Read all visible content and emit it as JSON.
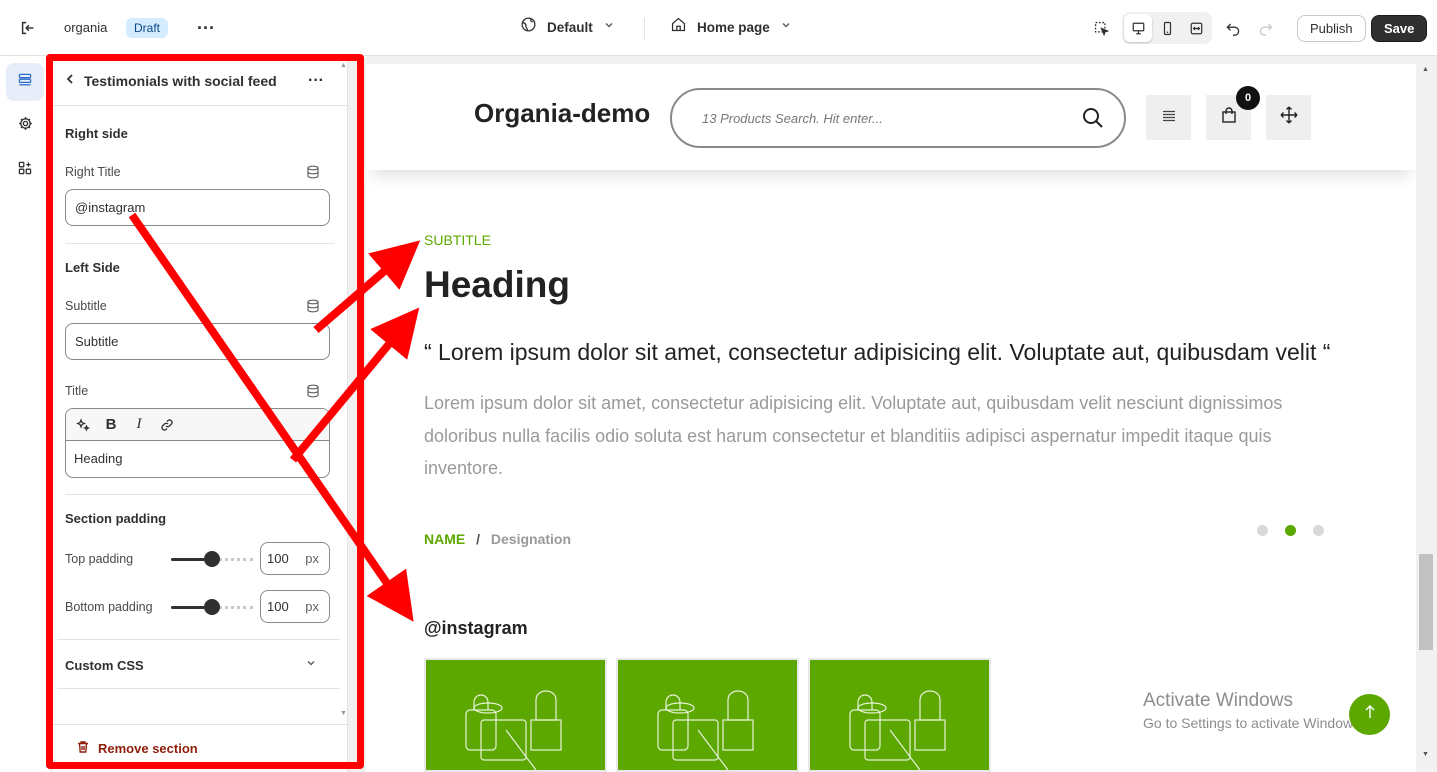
{
  "topbar": {
    "store_name": "organia",
    "status_badge": "Draft",
    "theme_selector": "Default",
    "page_selector": "Home page",
    "publish_label": "Publish",
    "save_label": "Save"
  },
  "panel": {
    "title": "Testimonials with social feed",
    "right_side": {
      "heading": "Right side",
      "right_title_label": "Right Title",
      "right_title_value": "@instagram"
    },
    "left_side": {
      "heading": "Left Side",
      "subtitle_label": "Subtitle",
      "subtitle_value": "Subtitle",
      "title_label": "Title",
      "title_value": "Heading"
    },
    "padding": {
      "heading": "Section padding",
      "top_label": "Top padding",
      "top_value": "100",
      "bottom_label": "Bottom padding",
      "bottom_value": "100",
      "unit": "px",
      "top_slider_fraction": 0.5,
      "bottom_slider_fraction": 0.5
    },
    "custom_css_label": "Custom CSS",
    "remove_label": "Remove section"
  },
  "preview": {
    "site_name": "Organia-demo",
    "search_placeholder": "13 Products Search. Hit enter...",
    "cart_count": "0",
    "subtitle": "SUBTITLE",
    "heading": "Heading",
    "quote": "“ Lorem ipsum dolor sit amet, consectetur adipisicing elit. Voluptate aut, quibusdam velit “",
    "body": "Lorem ipsum dolor sit amet, consectetur adipisicing elit. Voluptate aut, quibusdam velit nesciunt dignissimos doloribus nulla facilis odio soluta est harum consectetur et blanditiis adipisci aspernatur impedit itaque quis inventore.",
    "author_name": "NAME",
    "separator": "/",
    "designation": "Designation",
    "carousel_active_index": 1,
    "social_title": "@instagram"
  },
  "watermark": {
    "line1": "Activate Windows",
    "line2": "Go to Settings to activate Windows."
  },
  "colors": {
    "accent_green": "#5da800",
    "annotation_red": "#ff0000",
    "danger": "#8e1f0b"
  },
  "icons": [
    "exit-icon",
    "more-icon",
    "globe-icon",
    "home-icon",
    "chevron-down-icon",
    "inspect-icon",
    "desktop-icon",
    "mobile-icon",
    "fullwidth-icon",
    "undo-icon",
    "redo-icon",
    "sections-icon",
    "settings-icon",
    "apps-icon",
    "back-icon",
    "database-icon",
    "magic-icon",
    "bold-icon",
    "italic-icon",
    "link-icon",
    "trash-icon",
    "search-icon",
    "menu-icon",
    "bag-icon",
    "move-icon",
    "arrow-up-icon"
  ]
}
